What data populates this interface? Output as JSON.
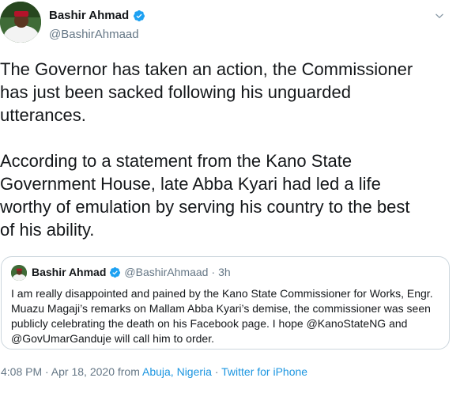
{
  "author": {
    "name": "Bashir Ahmad",
    "handle": "@BashirAhmaad"
  },
  "tweet": {
    "text": "The Governor has taken an action, the Commissioner\nhas just been sacked following his unguarded\nutterances.\n\nAccording to a statement from the Kano State\nGovernment House, late Abba Kyari had led a life\nworthy of emulation by serving his country to the best\nof his ability."
  },
  "quote": {
    "name": "Bashir Ahmad",
    "handle": "@BashirAhmaad",
    "separator": "·",
    "time": "3h",
    "text": "I am really disappointed and pained by the Kano State Commissioner for Works, Engr. Muazu Magaji’s remarks on Mallam Abba Kyari’s demise, the commissioner was seen publicly celebrating the death on his Facebook page. I hope @KanoStateNG and @GovUmarGanduje will call him to order."
  },
  "meta": {
    "timestamp": "4:08 PM · Apr 18, 2020 from ",
    "location": "Abuja, Nigeria",
    "separator": " · ",
    "source": "Twitter for iPhone"
  },
  "colors": {
    "verified": "#1da1f2",
    "link": "#1b95e0",
    "secondary_text": "#657786"
  },
  "icons": [
    "avatar",
    "verified-badge-icon",
    "chevron-down-icon"
  ]
}
